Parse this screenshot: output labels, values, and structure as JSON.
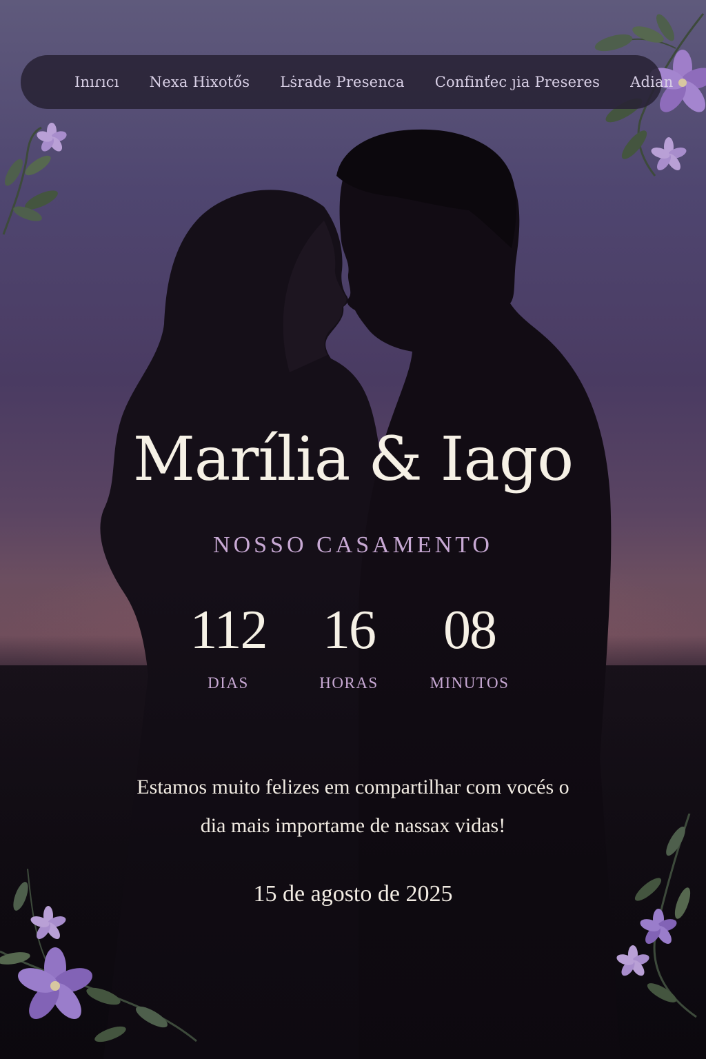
{
  "nav": {
    "items": [
      {
        "label": "Inıɾıcı"
      },
      {
        "label": "Nexa Hixotős"
      },
      {
        "label": "Lṡrade Presenca"
      },
      {
        "label": "Confinťec ȷia Preseres"
      },
      {
        "label": "Adian"
      }
    ]
  },
  "hero": {
    "title": "Marília & Iago",
    "subtitle": "NOSSO CASAMENTO"
  },
  "countdown": {
    "days": {
      "value": "112",
      "label": "DIAS"
    },
    "hours": {
      "value": "16",
      "label": "HORAS"
    },
    "minutes": {
      "value": "08",
      "label": "MINUTOS"
    }
  },
  "message": {
    "line1": "Estamos muito felizes em compartilhar com vocés o",
    "line2": "dia mais importame de nassax vidas!"
  },
  "event_date": "15 de agosto de 2025",
  "colors": {
    "text_cream": "#f6f1e6",
    "accent_lilac": "#c8a9d4",
    "nav_bg": "#28223a",
    "flower": "#9b7cc7",
    "leaf": "#4c5a4a"
  },
  "icons": {
    "decor": [
      "floral-top-right-icon",
      "floral-top-left-icon",
      "floral-bottom-left-icon",
      "floral-bottom-right-icon"
    ]
  }
}
